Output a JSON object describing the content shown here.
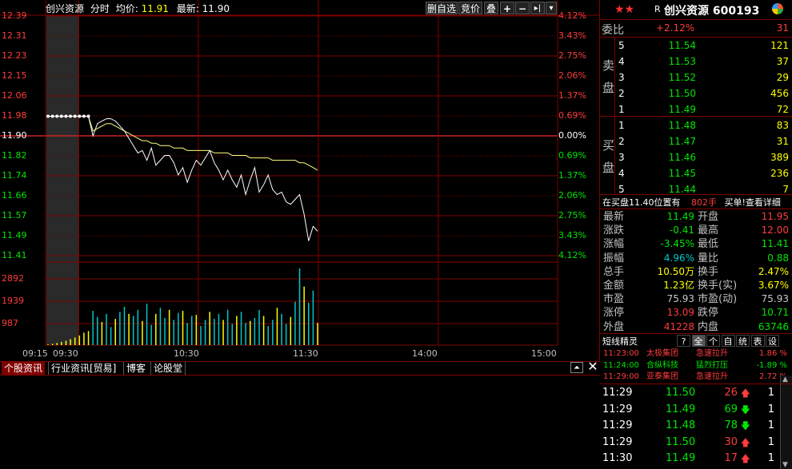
{
  "header": {
    "stock_name": "创兴资源",
    "mode": "分时",
    "avg_label": "均价:",
    "avg_value": "11.91",
    "last_label": "最新:",
    "last_value": "11.90",
    "toolbar": {
      "delete_label": "删自选",
      "auction_label": "竞价",
      "overlay_label": "叠",
      "plus": "+",
      "minus": "−",
      "next": "▸|",
      "dropdown": "▾"
    }
  },
  "price_axis": [
    "12.39",
    "12.31",
    "12.23",
    "12.15",
    "12.06",
    "11.98",
    "11.90",
    "11.82",
    "11.74",
    "11.66",
    "11.57",
    "11.49",
    "11.41"
  ],
  "pct_axis": [
    "4.12%",
    "3.43%",
    "2.75%",
    "2.06%",
    "1.37%",
    "0.69%",
    "0.00%",
    "0.69%",
    "1.37%",
    "2.06%",
    "2.75%",
    "3.43%",
    "4.12%"
  ],
  "volume_axis": [
    "2892",
    "1939",
    "987"
  ],
  "time_axis": [
    "09:15",
    "09:30",
    "10:30",
    "11:30",
    "14:00",
    "15:00"
  ],
  "chart_data": {
    "type": "line",
    "prev_close": 11.9,
    "ylim": [
      11.41,
      12.39
    ],
    "price": [
      11.98,
      11.98,
      11.98,
      11.98,
      11.98,
      11.98,
      11.98,
      11.98,
      11.98,
      11.98,
      11.9,
      11.95,
      11.96,
      11.97,
      11.97,
      11.96,
      11.94,
      11.92,
      11.89,
      11.86,
      11.83,
      11.84,
      11.8,
      11.85,
      11.78,
      11.8,
      11.82,
      11.82,
      11.79,
      11.74,
      11.77,
      11.71,
      11.76,
      11.8,
      11.78,
      11.81,
      11.84,
      11.79,
      11.76,
      11.72,
      11.76,
      11.72,
      11.69,
      11.74,
      11.66,
      11.72,
      11.77,
      11.67,
      11.7,
      11.74,
      11.68,
      11.66,
      11.67,
      11.63,
      11.62,
      11.64,
      11.66,
      11.58,
      11.47,
      11.53,
      11.51
    ],
    "avg": [
      11.98,
      11.98,
      11.98,
      11.98,
      11.98,
      11.98,
      11.98,
      11.98,
      11.98,
      11.98,
      11.92,
      11.93,
      11.94,
      11.95,
      11.95,
      11.94,
      11.93,
      11.92,
      11.91,
      11.9,
      11.89,
      11.88,
      11.88,
      11.87,
      11.87,
      11.86,
      11.86,
      11.86,
      11.85,
      11.85,
      11.85,
      11.84,
      11.84,
      11.84,
      11.84,
      11.84,
      11.84,
      11.83,
      11.83,
      11.83,
      11.83,
      11.82,
      11.82,
      11.82,
      11.82,
      11.81,
      11.81,
      11.81,
      11.81,
      11.81,
      11.8,
      11.8,
      11.8,
      11.8,
      11.8,
      11.8,
      11.79,
      11.79,
      11.78,
      11.77,
      11.76
    ],
    "volume": [
      40,
      70,
      110,
      160,
      220,
      300,
      380,
      480,
      620,
      700,
      1700,
      1400,
      1150,
      1550,
      900,
      1300,
      1650,
      1900,
      1550,
      1450,
      1750,
      1200,
      2050,
      1000,
      1550,
      1850,
      1350,
      1750,
      1250,
      1600,
      1700,
      1100,
      1450,
      1500,
      950,
      1250,
      1650,
      1300,
      1550,
      1250,
      1750,
      1050,
      1450,
      1650,
      1100,
      1200,
      1350,
      1750,
      1450,
      950,
      1250,
      1850,
      1550,
      1050,
      1400,
      2150,
      3800,
      2900,
      2100,
      2700,
      1100
    ]
  },
  "right_panel": {
    "title_prefix": "R",
    "title": "创兴资源 600193",
    "ratio_label": "委比",
    "ratio_value": "+2.12%",
    "ratio_diff": "31",
    "sell_label": [
      "卖",
      "盘"
    ],
    "buy_label": [
      "买",
      "盘"
    ],
    "asks": [
      {
        "level": "5",
        "price": "11.54",
        "vol": "121"
      },
      {
        "level": "4",
        "price": "11.53",
        "vol": "37"
      },
      {
        "level": "3",
        "price": "11.52",
        "vol": "29"
      },
      {
        "level": "2",
        "price": "11.50",
        "vol": "456"
      },
      {
        "level": "1",
        "price": "11.49",
        "vol": "72"
      }
    ],
    "bids": [
      {
        "level": "1",
        "price": "11.48",
        "vol": "83"
      },
      {
        "level": "2",
        "price": "11.47",
        "vol": "31"
      },
      {
        "level": "3",
        "price": "11.46",
        "vol": "389"
      },
      {
        "level": "4",
        "price": "11.45",
        "vol": "236"
      },
      {
        "level": "5",
        "price": "11.44",
        "vol": "7"
      }
    ],
    "notice": "在买盘11.40位置有",
    "notice_vol": "802手",
    "notice_link": "买单!查看详细",
    "quote": [
      {
        "l1": "最新",
        "v1": "11.49",
        "c1": "green",
        "l2": "开盘",
        "v2": "11.95",
        "c2": "red"
      },
      {
        "l1": "涨跌",
        "v1": "-0.41",
        "c1": "green",
        "l2": "最高",
        "v2": "12.00",
        "c2": "red"
      },
      {
        "l1": "涨幅",
        "v1": "-3.45%",
        "c1": "green",
        "l2": "最低",
        "v2": "11.41",
        "c2": "green"
      },
      {
        "l1": "振幅",
        "v1": "4.96%",
        "c1": "cyan",
        "l2": "量比",
        "v2": "0.88",
        "c2": "green"
      },
      {
        "l1": "总手",
        "v1": "10.50万",
        "c1": "yellow",
        "l2": "换手",
        "v2": "2.47%",
        "c2": "yellow"
      },
      {
        "l1": "金额",
        "v1": "1.23亿",
        "c1": "yellow",
        "l2": "换手(实)",
        "v2": "3.67%",
        "c2": "yellow"
      },
      {
        "l1": "市盈",
        "v1": "75.93",
        "c1": "gray",
        "l2": "市盈(动)",
        "v2": "75.93",
        "c2": "gray"
      },
      {
        "l1": "涨停",
        "v1": "13.09",
        "c1": "red",
        "l2": "跌停",
        "v2": "10.71",
        "c2": "green"
      },
      {
        "l1": "外盘",
        "v1": "41228",
        "c1": "red",
        "l2": "内盘",
        "v2": "63746",
        "c2": "green"
      }
    ],
    "short_title": "短线精灵",
    "short_tabs": [
      "?",
      "全",
      "个",
      "自",
      "统",
      "表",
      "设"
    ],
    "short_items": [
      {
        "time": "11:23:00",
        "name": "太极集团",
        "event": "急速拉升",
        "pct": "1.86 %",
        "color": "red"
      },
      {
        "time": "11:24:00",
        "name": "合纵科技",
        "event": "猛烈打压",
        "pct": "-1.89 %",
        "color": "green"
      },
      {
        "time": "11:29:00",
        "name": "亚泰集团",
        "event": "急速拉升",
        "pct": "2.72 %",
        "color": "red"
      }
    ],
    "ticks": [
      {
        "time": "11:29",
        "price": "11.50",
        "vol": "26",
        "dir": "up",
        "count": "1"
      },
      {
        "time": "11:29",
        "price": "11.49",
        "vol": "69",
        "dir": "down",
        "count": "1"
      },
      {
        "time": "11:29",
        "price": "11.48",
        "vol": "78",
        "dir": "down",
        "count": "1"
      },
      {
        "time": "11:29",
        "price": "11.50",
        "vol": "30",
        "dir": "up",
        "count": "1"
      },
      {
        "time": "11:30",
        "price": "11.49",
        "vol": "17",
        "dir": "up",
        "count": "1"
      }
    ]
  },
  "bottom_tabs": [
    "个股资讯",
    "行业资讯[贸易]",
    "博客",
    "论股堂"
  ]
}
